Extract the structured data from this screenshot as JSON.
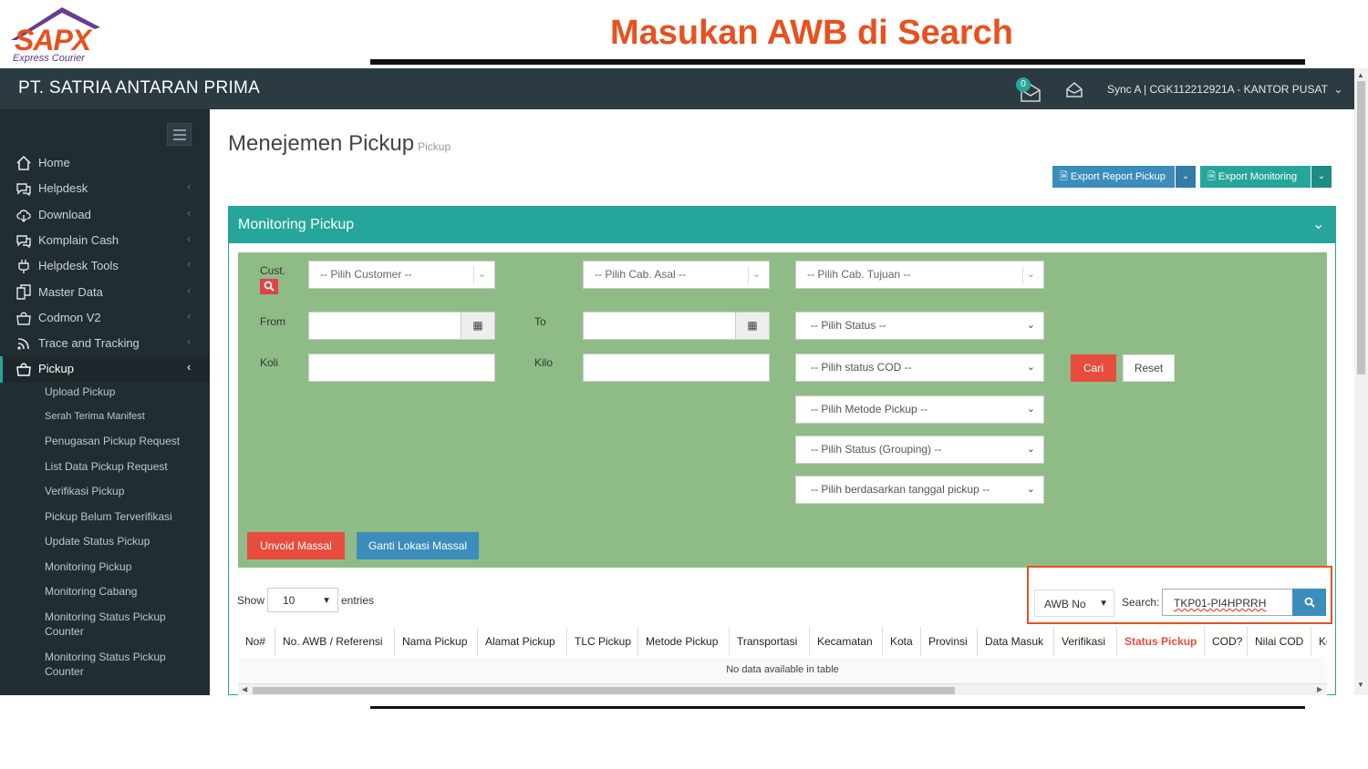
{
  "slide": {
    "logo_text": "SAPX",
    "logo_tagline": "Express Courier",
    "title": "Masukan AWB di Search"
  },
  "topbar": {
    "company": "PT. SATRIA ANTARAN PRIMA",
    "notification_count": "0",
    "user_info": "Sync A | CGK112212921A - KANTOR PUSAT"
  },
  "sidebar": {
    "items": [
      {
        "label": "Home",
        "icon": "home-icon"
      },
      {
        "label": "Helpdesk",
        "icon": "chat-icon"
      },
      {
        "label": "Download",
        "icon": "cloud-download-icon"
      },
      {
        "label": "Komplain Cash",
        "icon": "chat-icon"
      },
      {
        "label": "Helpdesk Tools",
        "icon": "plug-icon"
      },
      {
        "label": "Master Data",
        "icon": "copy-icon"
      },
      {
        "label": "Codmon V2",
        "icon": "bag-icon"
      },
      {
        "label": "Trace and Tracking",
        "icon": "rss-icon"
      },
      {
        "label": "Pickup",
        "icon": "bag-icon"
      }
    ],
    "pickup_submenu": [
      "Upload Pickup",
      "Serah Terima Manifest",
      "Penugasan Pickup Request",
      "List Data Pickup Request",
      "Verifikasi Pickup",
      "Pickup Belum Terverifikasi",
      "Update Status Pickup",
      "Monitoring Pickup",
      "Monitoring Cabang",
      "Monitoring Status Pickup Counter",
      "Monitoring Status Pickup Counter"
    ]
  },
  "page": {
    "title": "Menejemen Pickup",
    "subtitle": "Pickup",
    "export_report_label": "Export Report Pickup",
    "export_monitoring_label": "Export Monitoring"
  },
  "panel": {
    "title": "Monitoring Pickup"
  },
  "filter": {
    "cust_label": "Cust.",
    "from_label": "From",
    "to_label": "To",
    "koli_label": "Koli",
    "kilo_label": "Kilo",
    "customer_placeholder": "-- Pilih Customer --",
    "cab_asal_placeholder": "-- Pilih Cab. Asal --",
    "cab_tujuan_placeholder": "-- Pilih Cab. Tujuan --",
    "status": "-- Pilih Status --",
    "status_cod": "-- Pilih status COD --",
    "metode_pickup": "-- Pilih Metode Pickup --",
    "status_grouping": "-- Pilih Status (Grouping) --",
    "tanggal_pickup": "-- Pilih berdasarkan tanggal pickup --",
    "cari_label": "Cari",
    "reset_label": "Reset",
    "unvoid_label": "Unvoid Massal",
    "ganti_label": "Ganti Lokasi Massal"
  },
  "table_controls": {
    "show_label": "Show",
    "page_size": "10",
    "entries_label": "entries",
    "search_field": "AWB No",
    "search_label": "Search:",
    "search_value": "TKP01-PI4HPRRH"
  },
  "table": {
    "columns": [
      "No#",
      "No. AWB / Referensi",
      "Nama Pickup",
      "Alamat Pickup",
      "TLC Pickup",
      "Metode Pickup",
      "Transportasi",
      "Kecamatan",
      "Kota",
      "Provinsi",
      "Data Masuk",
      "Verifikasi",
      "Status Pickup",
      "COD?",
      "Nilai COD",
      "Ko"
    ],
    "highlight_column": "Status Pickup",
    "empty_message": "No data available in table"
  },
  "colors": {
    "accent_orange": "#e8511f",
    "teal": "#26a69a",
    "filter_green": "#8fbc86",
    "sidebar_dark": "#222d32",
    "topbar_dark": "#2c3b41",
    "btn_blue": "#3c8dbc",
    "btn_red": "#e74c3c"
  }
}
